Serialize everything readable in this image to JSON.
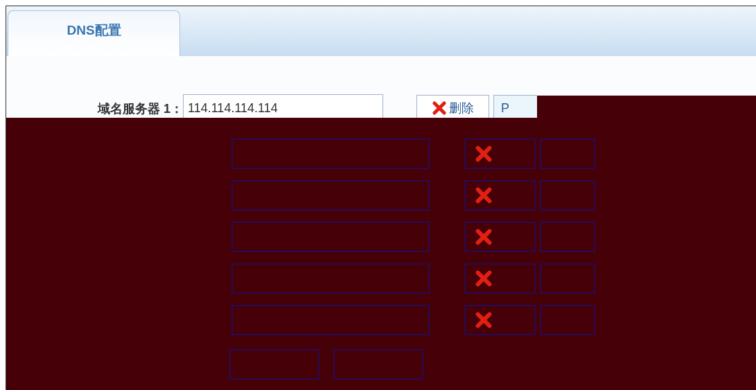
{
  "tabs": [
    {
      "label": "DNS配置",
      "selected": true
    }
  ],
  "dns_servers": [
    {
      "label": "域名服务器 1：",
      "value": "114.114.114.114",
      "delete_button": "删除",
      "ping_button": "P"
    }
  ],
  "masked_rows": [
    {
      "has_delete_icon": true
    },
    {
      "has_delete_icon": true
    },
    {
      "has_delete_icon": true
    },
    {
      "has_delete_icon": true
    },
    {
      "has_delete_icon": true
    }
  ],
  "masked_buttons": [
    {
      "kind": "button"
    },
    {
      "kind": "button"
    }
  ]
}
